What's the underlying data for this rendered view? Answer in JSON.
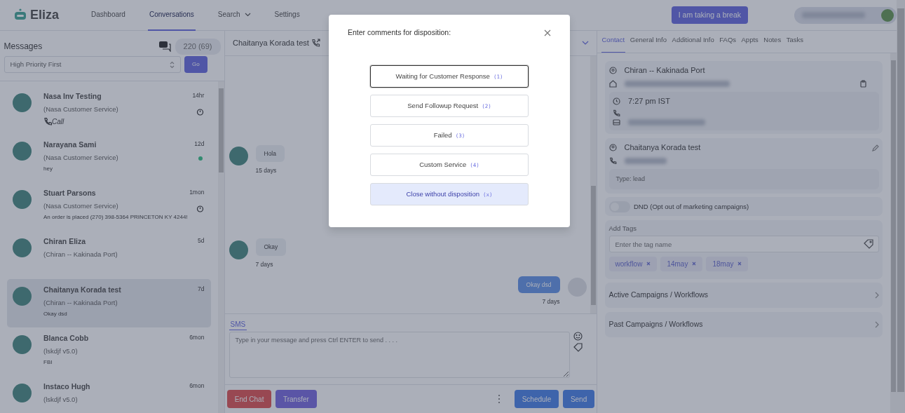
{
  "nav": {
    "logo": "Eliza",
    "links": [
      {
        "label": "Dashboard",
        "selected": false,
        "dropdown": false
      },
      {
        "label": "Conversations",
        "selected": true,
        "dropdown": false
      },
      {
        "label": "Search",
        "selected": false,
        "dropdown": true
      },
      {
        "label": "Settings",
        "selected": false,
        "dropdown": false
      }
    ],
    "break_button": "I am taking a break"
  },
  "messages_panel": {
    "title": "Messages",
    "count": "220 (69)",
    "sort": "High Priority First",
    "go": "Go",
    "conversations": [
      {
        "name": "Nasa Inv Testing",
        "team": "(Nasa Customer Service)",
        "preview": {
          "kind": "call",
          "text": "Call"
        },
        "time": "14hr",
        "timer": true,
        "online": false,
        "selected": false
      },
      {
        "name": "Narayana Sami",
        "team": "(Nasa Customer Service)",
        "preview": {
          "kind": "text",
          "text": "hey"
        },
        "time": "12d",
        "timer": false,
        "online": true,
        "selected": false
      },
      {
        "name": "Stuart Parsons",
        "team": "(Nasa Customer Service)",
        "preview": {
          "kind": "text",
          "text": "An order is placed (270) 398-5364 PRINCETON KY 4244!"
        },
        "time": "1mon",
        "timer": true,
        "online": false,
        "selected": false
      },
      {
        "name": "Chiran Eliza",
        "team": "(Chiran -- Kakinada Port)",
        "time": "5d",
        "timer": false,
        "online": false,
        "selected": false
      },
      {
        "name": "Chaitanya Korada test",
        "team": "(Chiran -- Kakinada Port)",
        "preview": {
          "kind": "text",
          "text": "Okay dsd"
        },
        "time": "7d",
        "timer": false,
        "online": false,
        "selected": true
      },
      {
        "name": "Blanca Cobb",
        "team": "(lskdjf v5.0)",
        "preview": {
          "kind": "text",
          "text": "FBI"
        },
        "time": "6mon",
        "timer": false,
        "online": false,
        "selected": false
      },
      {
        "name": "Instaco Hugh",
        "team": "(lskdjf v5.0)",
        "time": "6mon",
        "timer": false,
        "online": false,
        "selected": false
      }
    ]
  },
  "chat": {
    "contact_name": "Chaitanya Korada test",
    "messages": [
      {
        "kind": "incoming",
        "text": "Hola",
        "time": "15 days"
      },
      {
        "kind": "incoming",
        "text": "Okay",
        "time": "7 days"
      },
      {
        "kind": "outgoing",
        "text": "Okay dsd",
        "time": "7 days"
      }
    ],
    "compose": {
      "tab": "SMS",
      "placeholder": "Type in your message and press Ctrl ENTER to send . . . ."
    },
    "buttons": [
      {
        "label": "End Chat",
        "kind": "danger"
      },
      {
        "label": "Transfer",
        "kind": "secondary"
      },
      {
        "label": "Schedule",
        "kind": "primary"
      },
      {
        "label": "Send",
        "kind": "primary"
      }
    ]
  },
  "contact_panel": {
    "tabs": [
      {
        "label": "Contact",
        "selected": true
      },
      {
        "label": "General Info",
        "selected": false
      },
      {
        "label": "Additional Info",
        "selected": false
      },
      {
        "label": "FAQs",
        "selected": false
      },
      {
        "label": "Appts",
        "selected": false
      },
      {
        "label": "Notes",
        "selected": false
      },
      {
        "label": "Tasks",
        "selected": false
      }
    ],
    "location": "Chiran -- Kakinada Port",
    "local_time": "7:27 pm IST",
    "contact_name": "Chaitanya Korada test",
    "type": "Type: lead",
    "dnd": {
      "label": "DND (Opt out of marketing campaigns)",
      "on": false
    },
    "tags": {
      "label": "Add Tags",
      "placeholder": "Enter the tag name",
      "items": [
        "workflow",
        "14may",
        "18may"
      ]
    },
    "sections": [
      "Active Campaigns / Workflows",
      "Past Campaigns / Workflows"
    ]
  },
  "modal": {
    "title": "Enter comments for disposition:",
    "options": [
      {
        "label": "Waiting for Customer Response",
        "key": "(1)",
        "kind": "option",
        "focused": true
      },
      {
        "label": "Send Followup Request",
        "key": "(2)",
        "kind": "option",
        "focused": false
      },
      {
        "label": "Failed",
        "key": "(3)",
        "kind": "option",
        "focused": false
      },
      {
        "label": "Custom Service",
        "key": "(4)",
        "kind": "option",
        "focused": false
      },
      {
        "label": "Close without disposition",
        "key": "(x)",
        "kind": "cancel",
        "focused": false
      }
    ]
  }
}
